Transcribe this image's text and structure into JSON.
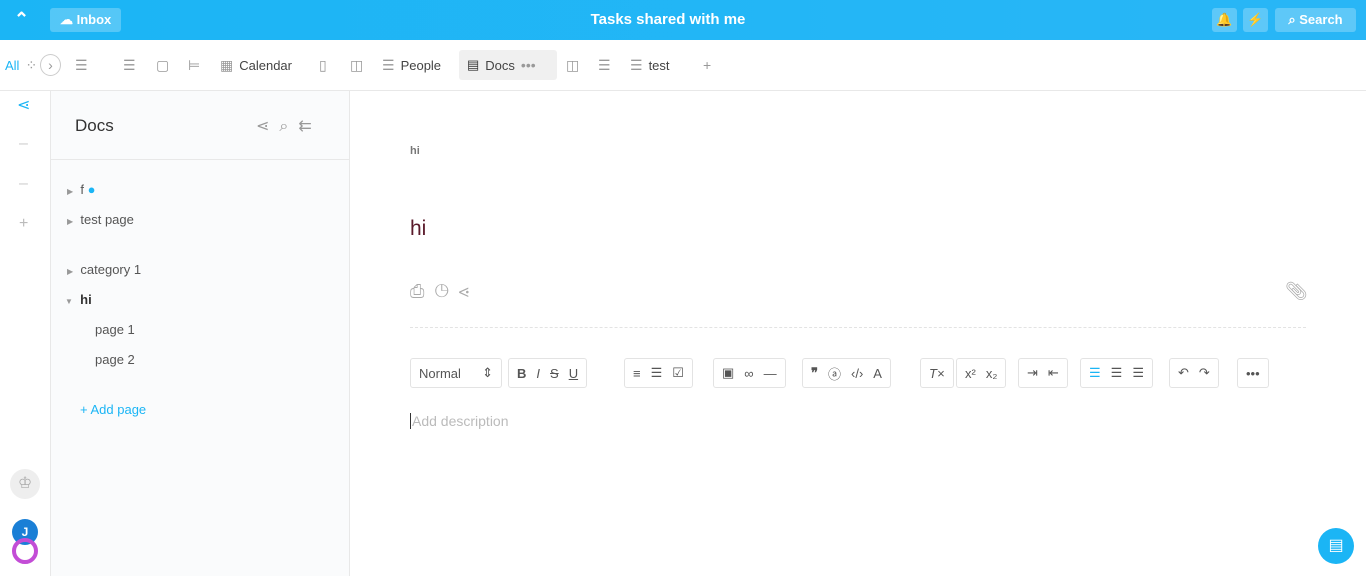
{
  "header": {
    "inbox": "Inbox",
    "title": "Tasks shared with me",
    "search": "Search"
  },
  "views": {
    "all": "All",
    "calendar": "Calendar",
    "people": "People",
    "docs": "Docs",
    "test": "test"
  },
  "sidebar": {
    "title": "Docs",
    "items": [
      {
        "label": "f"
      },
      {
        "label": "test page"
      },
      {
        "label": "category 1"
      },
      {
        "label": "hi"
      },
      {
        "label": "page 1"
      },
      {
        "label": "page 2"
      }
    ],
    "add_page": "+ Add page"
  },
  "doc": {
    "breadcrumb": "hi",
    "title": "hi",
    "style_select": "Normal",
    "description_placeholder": "Add description"
  },
  "user": {
    "initial": "J"
  },
  "colors": {
    "accent": "#1bb5f5"
  }
}
